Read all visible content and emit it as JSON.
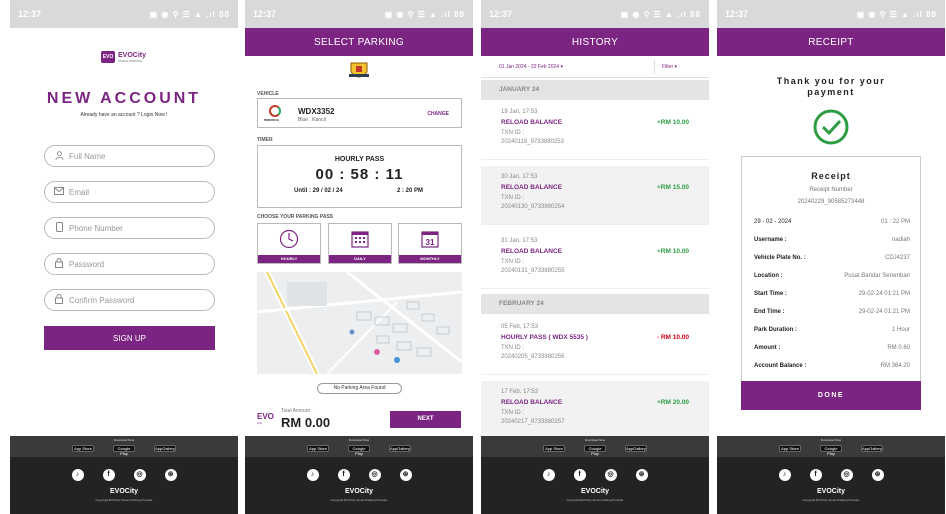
{
  "status": {
    "time": "12:37",
    "left_icons": "◀ ◎",
    "right_icons": "▣ ◉ ⚲ ☰ ▲ .ıl",
    "battery": "88"
  },
  "brand": {
    "badge": "EVO",
    "name": "EVOCity",
    "tag": "SMART PARKING",
    "accent": "#7b2481"
  },
  "footer": {
    "download_text": "Download Now",
    "stores": [
      "App Store",
      "Google Play",
      "AppGallery"
    ],
    "social_icons": [
      "tiktok-icon",
      "facebook-icon",
      "instagram-icon",
      "dribbble-icon"
    ],
    "logo": "EVOCity",
    "copyright": "Copyright EVOCity Smart Parking Provider"
  },
  "signup": {
    "title": "NEW ACCOUNT",
    "login_prompt": "Already have an account ? Login Now !",
    "fields": [
      {
        "placeholder": "Full Name",
        "icon": "user-icon"
      },
      {
        "placeholder": "Email",
        "icon": "mail-icon"
      },
      {
        "placeholder": "Phone Number",
        "icon": "phone-icon"
      },
      {
        "placeholder": "Password",
        "icon": "lock-icon"
      },
      {
        "placeholder": "Confirm Password",
        "icon": "lock-icon"
      }
    ],
    "button": "SIGN UP"
  },
  "select_parking": {
    "title": "SELECT PARKING",
    "vehicle_label": "VEHICLE",
    "vehicle": {
      "brand": "PERODUA",
      "plate": "WDX3352",
      "model": "Blue . Kancil",
      "change": "CHANGE"
    },
    "timer_label": "TIMER",
    "timer": {
      "pass": "HOURLY PASS",
      "remaining": "00 : 58 : 11",
      "until_date": "Until : 29 / 02 / 24",
      "until_time": "2 : 20 PM"
    },
    "pass_label": "CHOOSE YOUR PARKING PASS",
    "passes": [
      {
        "label": "HOURLY",
        "icon": "clock-icon"
      },
      {
        "label": "DAILY",
        "icon": "calendar-grid-icon"
      },
      {
        "label": "MONTHLY",
        "icon": "calendar-31-icon",
        "day": "31"
      }
    ],
    "no_area": "No Parking Area Found",
    "evo": "EVO",
    "evo_sub": "City",
    "total_label": "Total Amount :",
    "total_value": "RM 0.00",
    "next": "NEXT"
  },
  "history": {
    "title": "HISTORY",
    "date_range": "01 Jan 2024 - 22 Feb 2024",
    "filter": "Filter",
    "months": [
      {
        "name": "JANUARY 24",
        "items": [
          {
            "date": "19 Jan, 17:53",
            "title": "RELOAD BALANCE",
            "txn_label": "TXN ID :",
            "txn": "20240119_9733880253",
            "amount": "+RM 10.00",
            "negative": false
          },
          {
            "date": "30 Jan, 17:53",
            "title": "RELOAD BALANCE",
            "txn_label": "TXN ID :",
            "txn": "20240130_9733880254",
            "amount": "+RM 15.00",
            "negative": false
          },
          {
            "date": "31 Jan, 17:53",
            "title": "RELOAD BALANCE",
            "txn_label": "TXN ID :",
            "txn": "20240131_9733880255",
            "amount": "+RM 10.00",
            "negative": false
          }
        ]
      },
      {
        "name": "FEBRUARY 24",
        "items": [
          {
            "date": "05 Feb, 17:53",
            "title": "HOURLY PASS ( WDX 5535 )",
            "txn_label": "TXN ID :",
            "txn": "20240205_9733880256",
            "amount": "- RM 10.00",
            "negative": true
          },
          {
            "date": "17 Feb, 17:53",
            "title": "RELOAD BALANCE",
            "txn_label": "TXN ID :",
            "txn": "20240217_9733880257",
            "amount": "+RM 20.00",
            "negative": false
          }
        ]
      }
    ],
    "positive_color": "#2e9c43",
    "negative_color": "#d0021b"
  },
  "receipt": {
    "title": "RECEIPT",
    "thanks_line1": "Thank you for your",
    "thanks_line2": "payment",
    "card_title": "Receipt",
    "number_label": "Receipt Number",
    "number_value": "20240229_90585273448",
    "date": "29 - 02 - 2024",
    "time": "01 : 22 PM",
    "rows": [
      {
        "k": "Username :",
        "v": "nadiah"
      },
      {
        "k": "Vehicle Plate No. :",
        "v": "CDJ4237"
      },
      {
        "k": "Location :",
        "v": "Pusat Bandar Seremban"
      },
      {
        "k": "Start Time :",
        "v": "29-02-24 01:21 PM"
      },
      {
        "k": "End Time :",
        "v": "29-02-24 01:21 PM"
      },
      {
        "k": "Park Duration :",
        "v": "1 Hour"
      },
      {
        "k": "Amount :",
        "v": "RM 0.60"
      },
      {
        "k": "Account Balance :",
        "v": "RM 364.20"
      }
    ],
    "done": "DONE"
  }
}
